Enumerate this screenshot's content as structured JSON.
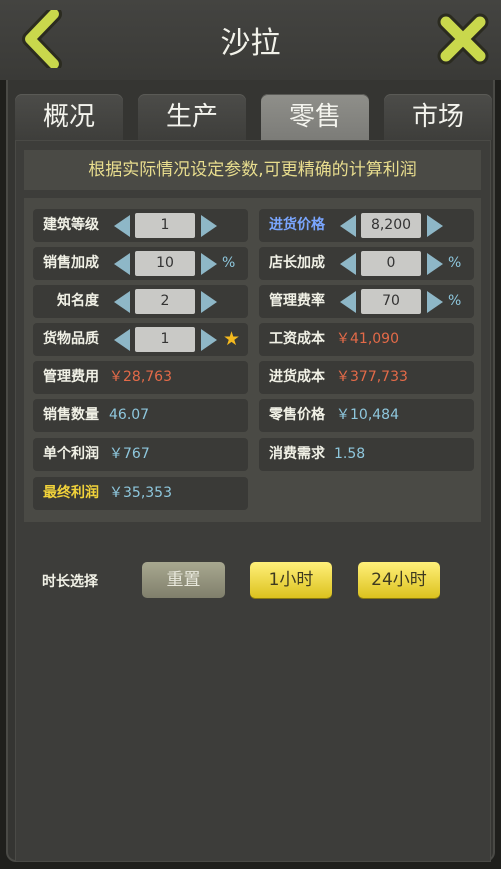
{
  "header": {
    "title": "沙拉",
    "accent": "#c7d84a"
  },
  "tabs": [
    {
      "label": "概况"
    },
    {
      "label": "生产"
    },
    {
      "label": "零售",
      "active": true
    },
    {
      "label": "市场"
    }
  ],
  "notice": "根据实际情况设定参数,可更精确的计算利润",
  "fields": {
    "building_level": {
      "label": "建筑等级",
      "value": "1"
    },
    "purchase_price": {
      "label": "进货价格",
      "value": "8,200"
    },
    "sales_bonus": {
      "label": "销售加成",
      "value": "10",
      "unit": "%"
    },
    "manager_bonus": {
      "label": "店长加成",
      "value": "0",
      "unit": "%"
    },
    "popularity": {
      "label": "知名度",
      "value": "2"
    },
    "mgmt_rate": {
      "label": "管理费率",
      "value": "70",
      "unit": "%"
    },
    "quality": {
      "label": "货物品质",
      "value": "1"
    },
    "wage_cost": {
      "label": "工资成本",
      "value": "￥41,090"
    },
    "mgmt_fee": {
      "label": "管理费用",
      "value": "￥28,763"
    },
    "purchase_cost": {
      "label": "进货成本",
      "value": "￥377,733"
    },
    "sales_qty": {
      "label": "销售数量",
      "value": "46.07"
    },
    "retail_price": {
      "label": "零售价格",
      "value": "￥10,484"
    },
    "unit_profit": {
      "label": "单个利润",
      "value": "￥767"
    },
    "demand": {
      "label": "消费需求",
      "value": "1.58"
    },
    "final_profit": {
      "label": "最终利润",
      "value": "￥35,353"
    }
  },
  "duration": {
    "label": "时长选择",
    "reset": "重置",
    "one_hour": "1小时",
    "day": "24小时"
  }
}
